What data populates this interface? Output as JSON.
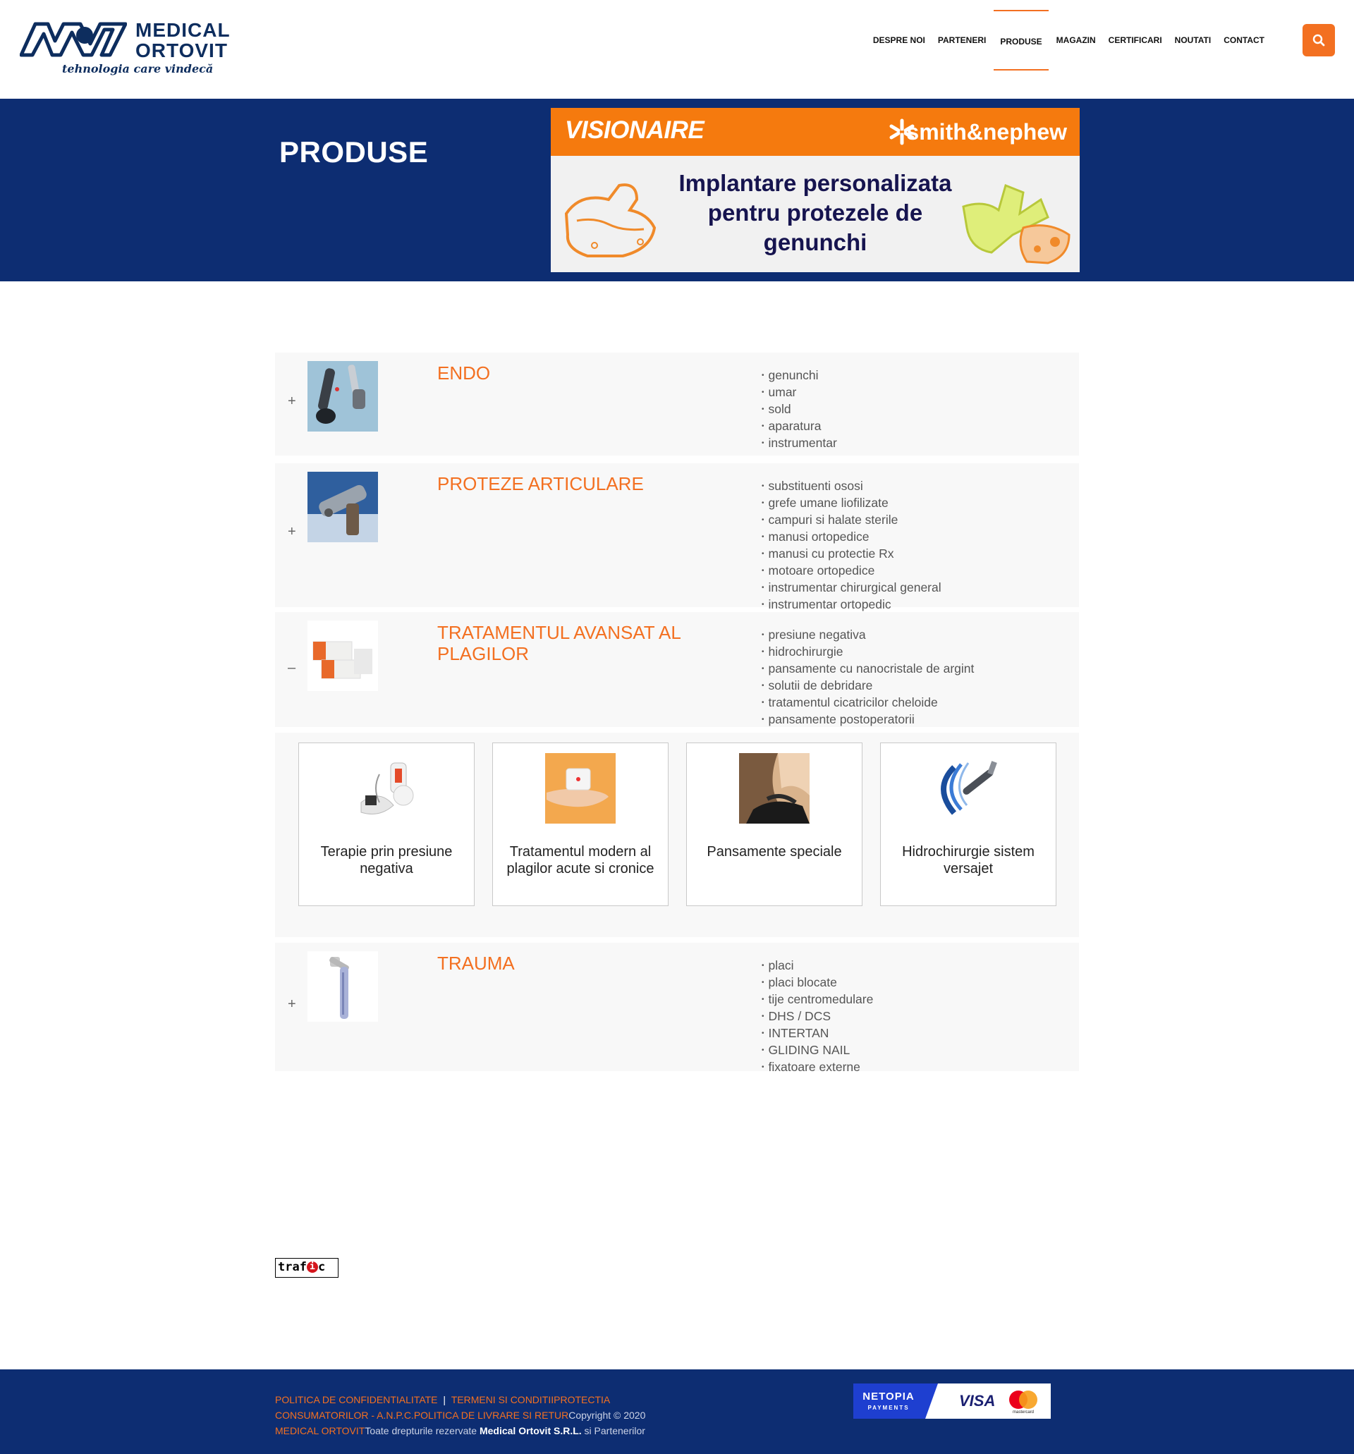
{
  "brand": {
    "line1": "MEDICAL",
    "line2": "ORTOVIT",
    "tagline": "tehnologia care vindecă"
  },
  "nav": {
    "items": [
      {
        "label": "DESPRE NOI"
      },
      {
        "label": "PARTENERI"
      },
      {
        "label": "PRODUSE"
      },
      {
        "label": "MAGAZIN"
      },
      {
        "label": "CERTIFICARI"
      },
      {
        "label": "NOUTATI"
      },
      {
        "label": "CONTACT"
      }
    ],
    "active_label": "PRODUSE"
  },
  "hero": {
    "title": "PRODUSE",
    "banner": {
      "brand": "VISIONAIRE",
      "partner": "smith&nephew",
      "headline": "Implantare personalizata pentru protezele de genunchi"
    }
  },
  "categories": [
    {
      "toggle": "+",
      "title": "ENDO",
      "items": [
        "genunchi",
        "umar",
        "sold",
        "aparatura",
        "instrumentar"
      ]
    },
    {
      "toggle": "+",
      "title": "PROTEZE ARTICULARE",
      "items": [
        "substituenti ososi",
        "grefe umane liofilizate",
        "campuri si halate sterile",
        "manusi ortopedice",
        "manusi cu protectie Rx",
        "motoare ortopedice",
        "instrumentar chirurgical general",
        "instrumentar ortopedic"
      ]
    },
    {
      "toggle": "–",
      "title": "TRATAMENTUL AVANSAT AL PLAGILOR",
      "items": [
        "presiune negativa",
        "hidrochirurgie",
        "pansamente cu nanocristale de argint",
        "solutii de debridare",
        "tratamentul cicatricilor cheloide",
        "pansamente postoperatorii"
      ]
    },
    {
      "toggle": "+",
      "title": "TRAUMA",
      "items": [
        "placi",
        "placi blocate",
        "tije centromedulare",
        "DHS / DCS",
        "INTERTAN",
        "GLIDING NAIL",
        "fixatoare externe"
      ]
    }
  ],
  "subcategories": [
    {
      "label": "Terapie prin presiune negativa"
    },
    {
      "label": "Tratamentul modern al plagilor acute si cronice"
    },
    {
      "label": "Pansamente speciale"
    },
    {
      "label": "Hidrochirurgie sistem versajet"
    }
  ],
  "counter": {
    "label_pre": "traf",
    "label_dot": "i",
    "label_post": "c"
  },
  "footer": {
    "link_privacy": "POLITICA DE CONFIDENTIALITATE",
    "separator": "|",
    "link_terms": "TERMENI SI CONDITII",
    "link_anpc": "PROTECTIA CONSUMATORILOR - A.N.P.C.",
    "link_delivery": "POLITICA DE LIVRARE SI RETUR",
    "copyright": "Copyright © 2020",
    "company_link": "MEDICAL ORTOVIT",
    "rights_pre": "Toate drepturile rezervate ",
    "rights_company": "Medical Ortovit S.R.L.",
    "rights_post": " si Partenerilor",
    "payments": {
      "netopia": "NETOPIA",
      "netopia_sub": "PAYMENTS",
      "visa": "VISA",
      "mastercard": "mastercard"
    }
  },
  "colors": {
    "accent": "#f37021",
    "navy": "#0d2d72",
    "row_bg": "#f8f8f8"
  }
}
